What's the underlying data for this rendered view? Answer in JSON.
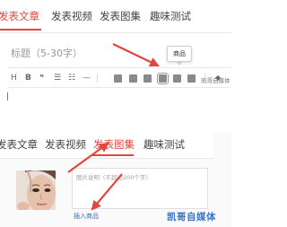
{
  "editor_tabs": [
    {
      "label": "发表文章",
      "active": true
    },
    {
      "label": "发表视频",
      "active": false
    },
    {
      "label": "发表图集",
      "active": false
    },
    {
      "label": "趣味测试",
      "active": false
    }
  ],
  "title": {
    "placeholder": "标题（5-30字）"
  },
  "tooltip": {
    "label": "商品"
  },
  "toolbar": {
    "heading": "H",
    "bold": "B",
    "quote": "❝",
    "ordered_list": "☰",
    "unordered_list": "☷",
    "rule": "—",
    "buttons": [
      "image",
      "picture",
      "video",
      "product",
      "audio",
      "vote"
    ]
  },
  "watermark_small": "凯哥自媒体",
  "panel2_tabs": [
    {
      "label": "发表文章",
      "active": false
    },
    {
      "label": "发表视频",
      "active": false
    },
    {
      "label": "发表图集",
      "active": true
    },
    {
      "label": "趣味测试",
      "active": false
    }
  ],
  "description": {
    "placeholder": "图片说明（不超过200个字）"
  },
  "insert_product": "插入商品",
  "watermark_logo": "凯哥自媒体",
  "colors": {
    "accent_red": "#e2463f",
    "link_blue": "#3b6fb6",
    "logo_blue": "#3d73c9"
  }
}
